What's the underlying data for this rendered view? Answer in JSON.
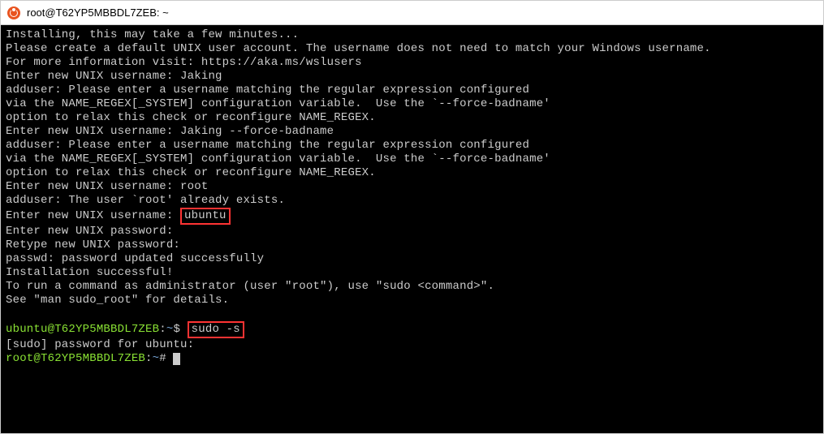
{
  "window": {
    "title": "root@T62YP5MBBDL7ZEB: ~"
  },
  "terminal": {
    "line1": "Installing, this may take a few minutes...",
    "line2": "Please create a default UNIX user account. The username does not need to match your Windows username.",
    "line3": "For more information visit: https://aka.ms/wslusers",
    "line4": "Enter new UNIX username: Jaking",
    "line5": "adduser: Please enter a username matching the regular expression configured",
    "line6": "via the NAME_REGEX[_SYSTEM] configuration variable.  Use the `--force-badname'",
    "line7": "option to relax this check or reconfigure NAME_REGEX.",
    "line8": "Enter new UNIX username: Jaking --force-badname",
    "line9": "adduser: Please enter a username matching the regular expression configured",
    "line10": "via the NAME_REGEX[_SYSTEM] configuration variable.  Use the `--force-badname'",
    "line11": "option to relax this check or reconfigure NAME_REGEX.",
    "line12": "Enter new UNIX username: root",
    "line13": "adduser: The user `root' already exists.",
    "line14a": "Enter new UNIX username: ",
    "line14b": "ubuntu",
    "line15": "Enter new UNIX password:",
    "line16": "Retype new UNIX password:",
    "line17": "passwd: password updated successfully",
    "line18": "Installation successful!",
    "line19": "To run a command as administrator (user \"root\"), use \"sudo <command>\".",
    "line20": "See \"man sudo_root\" for details.",
    "prompt1_user": "ubuntu@T62YP5MBBDL7ZEB",
    "prompt1_sep": ":",
    "prompt1_path": "~",
    "prompt1_dollar": "$ ",
    "prompt1_cmd": "sudo -s",
    "line22": "[sudo] password for ubuntu:",
    "prompt2_user": "root@T62YP5MBBDL7ZEB",
    "prompt2_sep": ":",
    "prompt2_path": "~",
    "prompt2_hash": "# "
  },
  "highlights": {
    "box1_value": "ubuntu",
    "box2_value": "sudo -s"
  }
}
